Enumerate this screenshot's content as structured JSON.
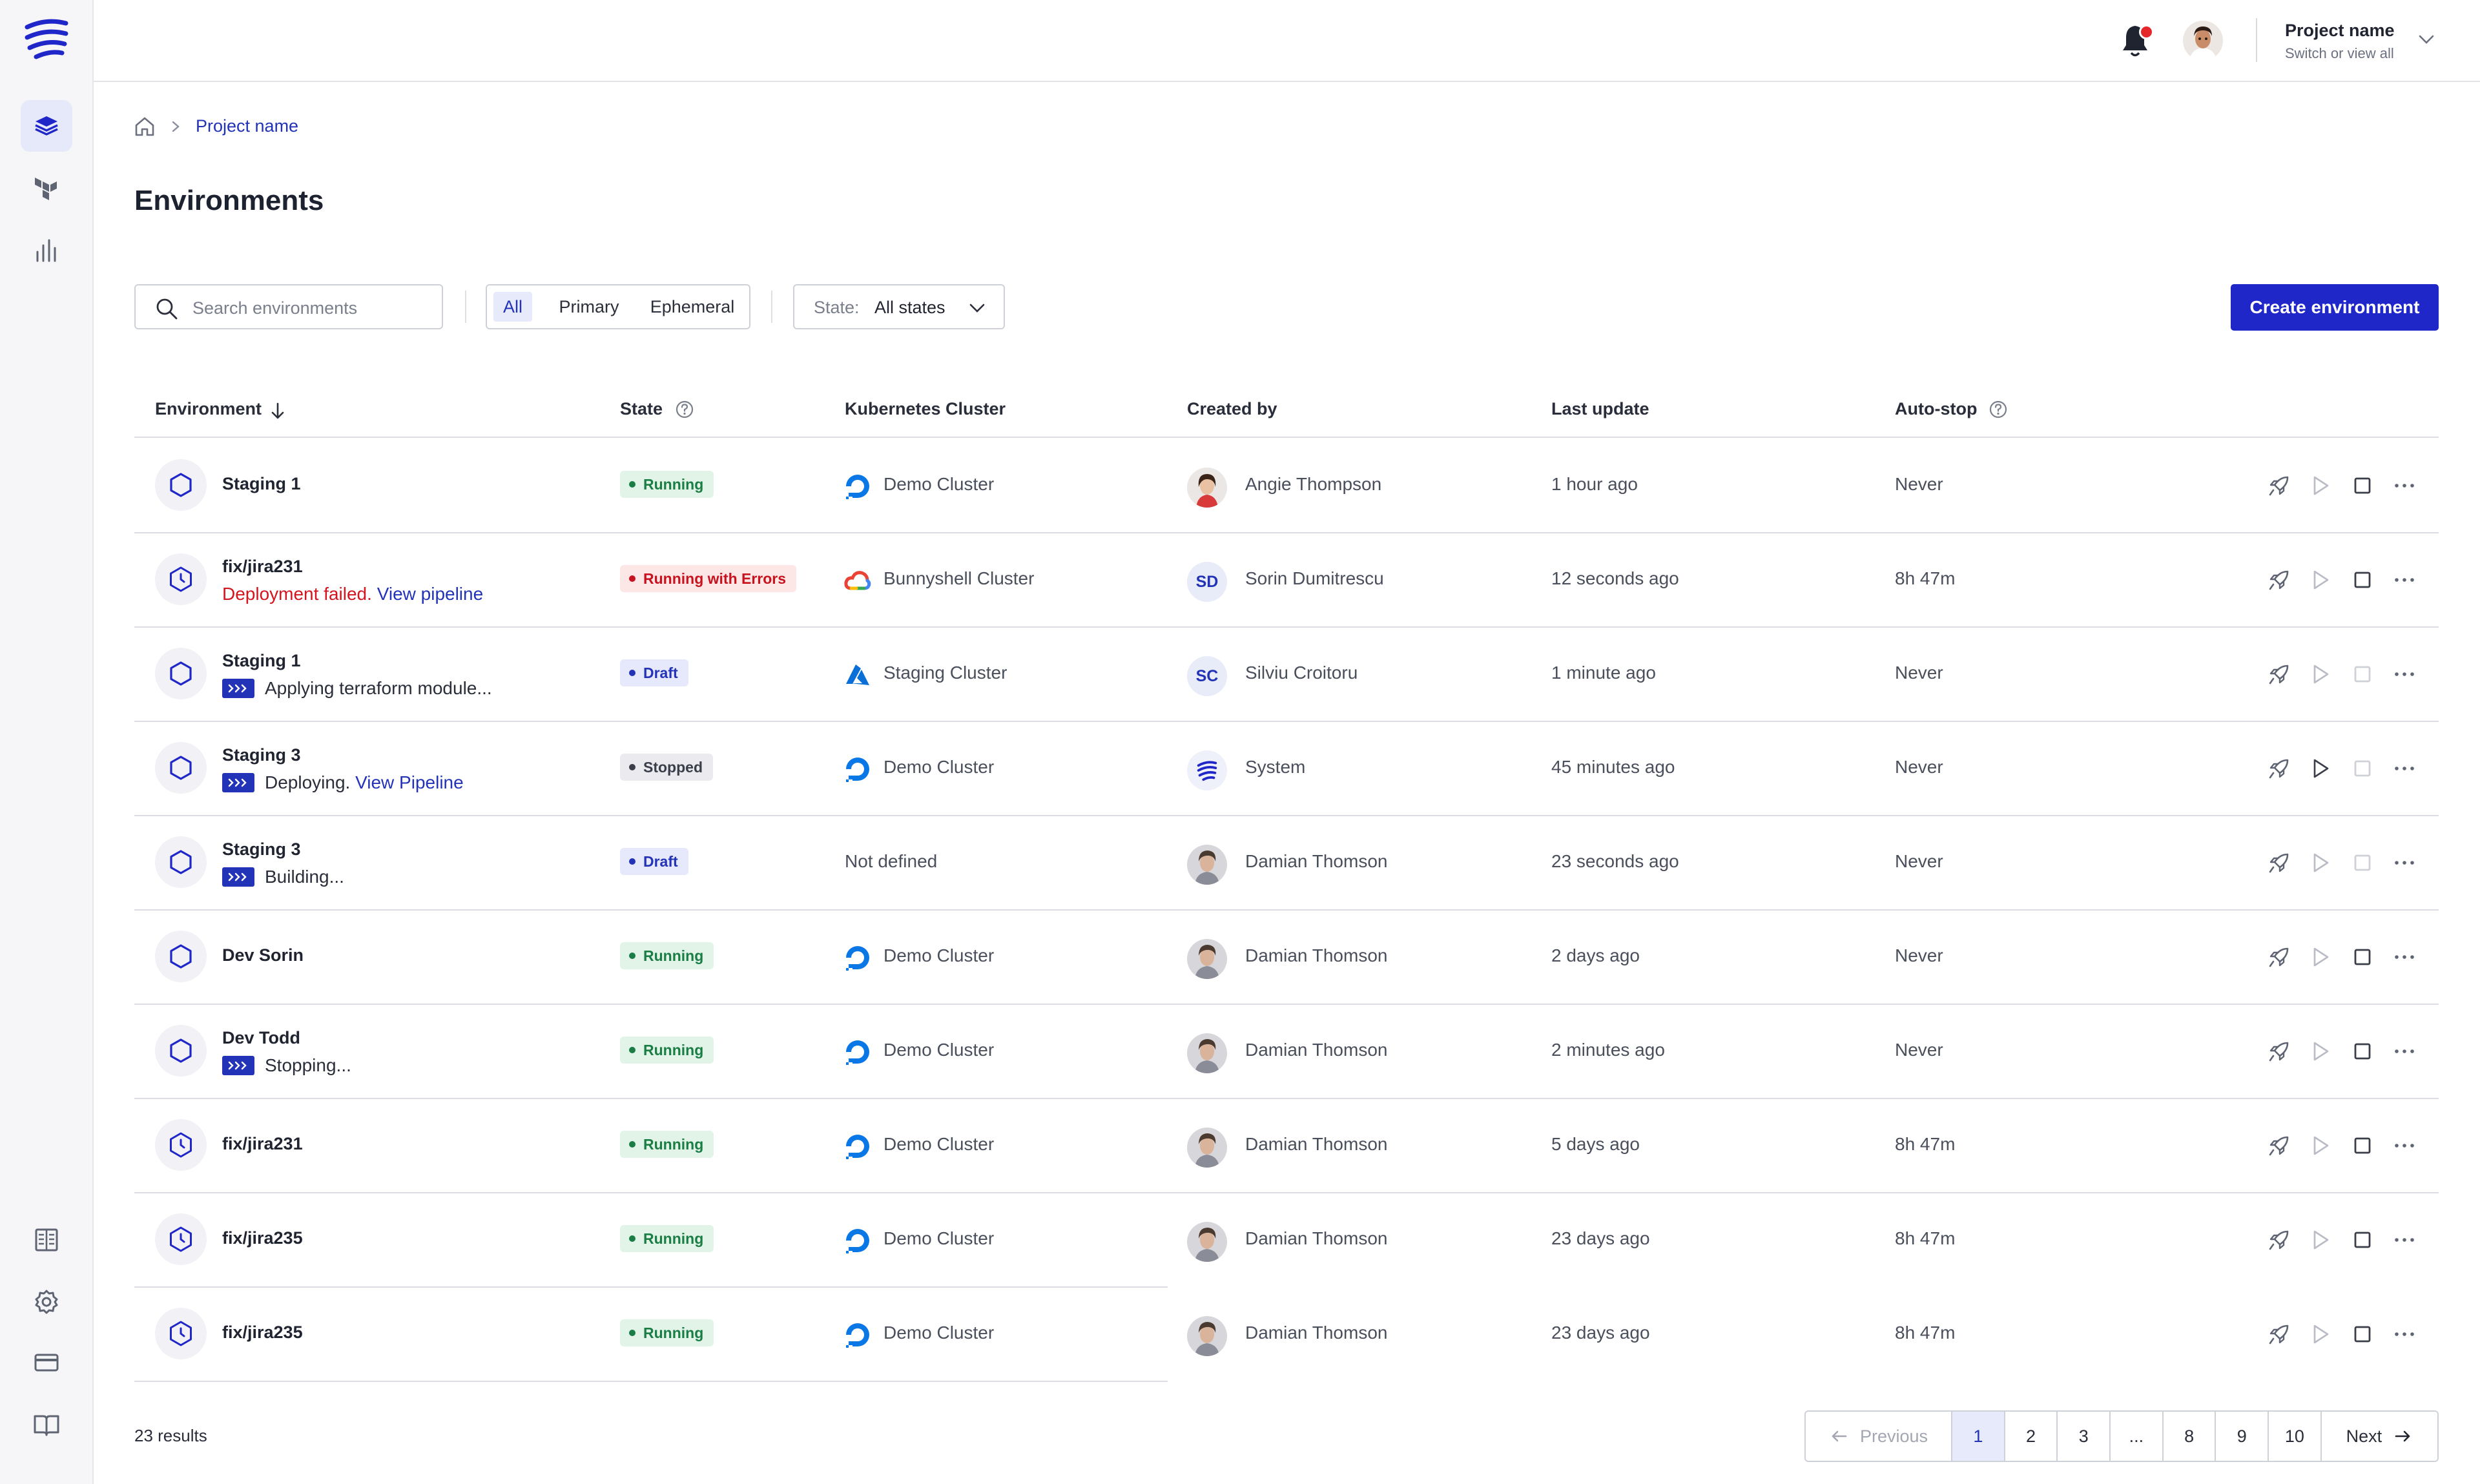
{
  "header": {
    "project_title": "Project name",
    "project_subtitle": "Switch or view all"
  },
  "breadcrumb": {
    "current": "Project name"
  },
  "page_title": "Environments",
  "toolbar": {
    "search_placeholder": "Search environments",
    "filters": [
      "All",
      "Primary",
      "Ephemeral"
    ],
    "active_filter": "All",
    "state_label": "State:",
    "state_value": "All states",
    "create_label": "Create environment"
  },
  "table": {
    "columns": [
      "Environment",
      "State",
      "Kubernetes Cluster",
      "Created by",
      "Last update",
      "Auto-stop"
    ],
    "rows": [
      {
        "name": "Staging 1",
        "icon": "hexagon",
        "sub_prefix": "",
        "sub_error": "",
        "sub_link": "",
        "pipeline": false,
        "state": "Running",
        "state_kind": "running",
        "cluster": "Demo Cluster",
        "cluster_icon": "digitalocean",
        "creator": "Angie Thompson",
        "avatar": "photo-a",
        "initials": "",
        "updated": "1 hour ago",
        "autostop": "Never"
      },
      {
        "name": "fix/jira231",
        "icon": "clock",
        "sub_prefix": "",
        "sub_error": "Deployment failed.",
        "sub_link": "View pipeline",
        "pipeline": false,
        "state": "Running with Errors",
        "state_kind": "errors",
        "cluster": "Bunnyshell Cluster",
        "cluster_icon": "gcloud",
        "creator": "Sorin Dumitrescu",
        "avatar": "initials",
        "initials": "SD",
        "updated": "12 seconds ago",
        "autostop": "8h 47m"
      },
      {
        "name": "Staging 1",
        "icon": "hexagon",
        "sub_prefix": "Applying terraform module...",
        "sub_error": "",
        "sub_link": "",
        "pipeline": true,
        "state": "Draft",
        "state_kind": "draft",
        "cluster": "Staging Cluster",
        "cluster_icon": "azure",
        "creator": "Silviu Croitoru",
        "avatar": "initials",
        "initials": "SC",
        "updated": "1 minute ago",
        "autostop": "Never"
      },
      {
        "name": "Staging 3",
        "icon": "hexagon",
        "sub_prefix": "Deploying.",
        "sub_error": "",
        "sub_link": "View Pipeline",
        "pipeline": true,
        "state": "Stopped",
        "state_kind": "stopped",
        "cluster": "Demo Cluster",
        "cluster_icon": "digitalocean",
        "creator": "System",
        "avatar": "system",
        "initials": "",
        "updated": "45 minutes ago",
        "autostop": "Never"
      },
      {
        "name": "Staging 3",
        "icon": "hexagon",
        "sub_prefix": "Building...",
        "sub_error": "",
        "sub_link": "",
        "pipeline": true,
        "state": "Draft",
        "state_kind": "draft",
        "cluster": "Not defined",
        "cluster_icon": "none",
        "creator": "Damian Thomson",
        "avatar": "photo-b",
        "initials": "",
        "updated": "23 seconds ago",
        "autostop": "Never"
      },
      {
        "name": "Dev Sorin",
        "icon": "hexagon",
        "sub_prefix": "",
        "sub_error": "",
        "sub_link": "",
        "pipeline": false,
        "state": "Running",
        "state_kind": "running",
        "cluster": "Demo Cluster",
        "cluster_icon": "digitalocean",
        "creator": "Damian Thomson",
        "avatar": "photo-b",
        "initials": "",
        "updated": "2 days ago",
        "autostop": "Never"
      },
      {
        "name": "Dev Todd",
        "icon": "hexagon",
        "sub_prefix": "Stopping...",
        "sub_error": "",
        "sub_link": "",
        "pipeline": true,
        "state": "Running",
        "state_kind": "running",
        "cluster": "Demo Cluster",
        "cluster_icon": "digitalocean",
        "creator": "Damian Thomson",
        "avatar": "photo-b",
        "initials": "",
        "updated": "2 minutes ago",
        "autostop": "Never"
      },
      {
        "name": "fix/jira231",
        "icon": "clock",
        "sub_prefix": "",
        "sub_error": "",
        "sub_link": "",
        "pipeline": false,
        "state": "Running",
        "state_kind": "running",
        "cluster": "Demo Cluster",
        "cluster_icon": "digitalocean",
        "creator": "Damian Thomson",
        "avatar": "photo-b",
        "initials": "",
        "updated": "5 days ago",
        "autostop": "8h 47m"
      },
      {
        "name": "fix/jira235",
        "icon": "clock",
        "sub_prefix": "",
        "sub_error": "",
        "sub_link": "",
        "pipeline": false,
        "state": "Running",
        "state_kind": "running",
        "cluster": "Demo Cluster",
        "cluster_icon": "digitalocean",
        "creator": "Damian Thomson",
        "avatar": "photo-b",
        "initials": "",
        "updated": "23 days ago",
        "autostop": "8h 47m"
      },
      {
        "name": "fix/jira235",
        "icon": "clock",
        "sub_prefix": "",
        "sub_error": "",
        "sub_link": "",
        "pipeline": false,
        "state": "Running",
        "state_kind": "running",
        "cluster": "Demo Cluster",
        "cluster_icon": "digitalocean",
        "creator": "Damian Thomson",
        "avatar": "photo-b",
        "initials": "",
        "updated": "23 days ago",
        "autostop": "8h 47m"
      }
    ],
    "row_actions": [
      {
        "play_enabled": false,
        "stop_enabled": true
      },
      {
        "play_enabled": false,
        "stop_enabled": true
      },
      {
        "play_enabled": false,
        "stop_enabled": false
      },
      {
        "play_enabled": true,
        "stop_enabled": false
      },
      {
        "play_enabled": false,
        "stop_enabled": false
      },
      {
        "play_enabled": false,
        "stop_enabled": true
      },
      {
        "play_enabled": false,
        "stop_enabled": true
      },
      {
        "play_enabled": false,
        "stop_enabled": true
      },
      {
        "play_enabled": false,
        "stop_enabled": true
      },
      {
        "play_enabled": false,
        "stop_enabled": true
      }
    ]
  },
  "footer": {
    "results": "23 results",
    "pagination": {
      "previous": "Previous",
      "pages": [
        "1",
        "2",
        "3",
        "...",
        "8",
        "9",
        "10"
      ],
      "current": "1",
      "next": "Next"
    }
  },
  "colors": {
    "brand": "#2027c9",
    "link": "#2333b8",
    "error": "#d4151f",
    "running": "#197d44",
    "notification": "#e5262b"
  }
}
